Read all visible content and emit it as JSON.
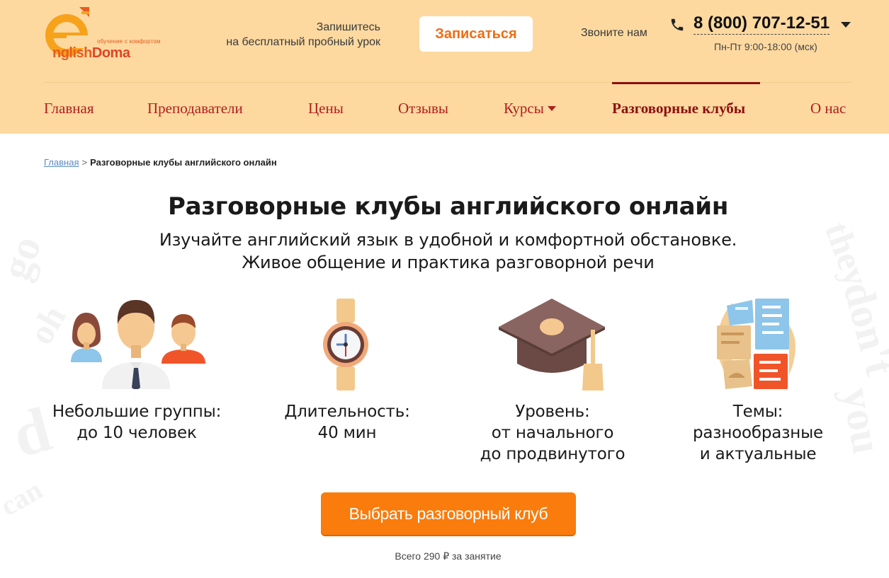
{
  "logo": {
    "tagline": "обучение с комфортом",
    "name_part1": "nglish",
    "name_part2": "Doma"
  },
  "header": {
    "signup_text_line1": "Запишитесь",
    "signup_text_line2": "на бесплатный пробный урок",
    "signup_button": "Записаться",
    "call_label": "Звоните нам",
    "phone": "8 (800) 707-12-51",
    "hours": "Пн-Пт 9:00-18:00 (мск)"
  },
  "nav": {
    "items": [
      {
        "label": "Главная"
      },
      {
        "label": "Преподаватели"
      },
      {
        "label": "Цены"
      },
      {
        "label": "Отзывы"
      },
      {
        "label": "Курсы"
      },
      {
        "label": "Разговорные клубы"
      },
      {
        "label": "О нас"
      }
    ]
  },
  "breadcrumb": {
    "home": "Главная",
    "separator": ">",
    "current": "Разговорные клубы английского онлайн"
  },
  "main": {
    "title": "Разговорные клубы английского онлайн",
    "subtitle_line1": "Изучайте английский язык в удобной и комфортной обстановке.",
    "subtitle_line2": "Живое общение и практика разговорной речи",
    "features": [
      {
        "icon": "group-people-icon",
        "line1": "Небольшие группы:",
        "line2": "до 10 человек",
        "line3": ""
      },
      {
        "icon": "wristwatch-icon",
        "line1": "Длительность:",
        "line2": "40 мин",
        "line3": ""
      },
      {
        "icon": "graduation-cap-icon",
        "line1": "Уровень:",
        "line2": "от начального",
        "line3": "до продвинутого"
      },
      {
        "icon": "topics-papers-icon",
        "line1": "Темы:",
        "line2": "разнообразные",
        "line3": "и актуальные"
      }
    ],
    "cta_button": "Выбрать разговорный клуб",
    "price_note": "Всего 290 ₽ за занятие"
  },
  "colors": {
    "header_bg": "#fdd9a0",
    "nav_text": "#b01e1e",
    "nav_active": "#8c0f0f",
    "cta_bg": "#f97c0d",
    "brand_orange": "#f06c12"
  }
}
